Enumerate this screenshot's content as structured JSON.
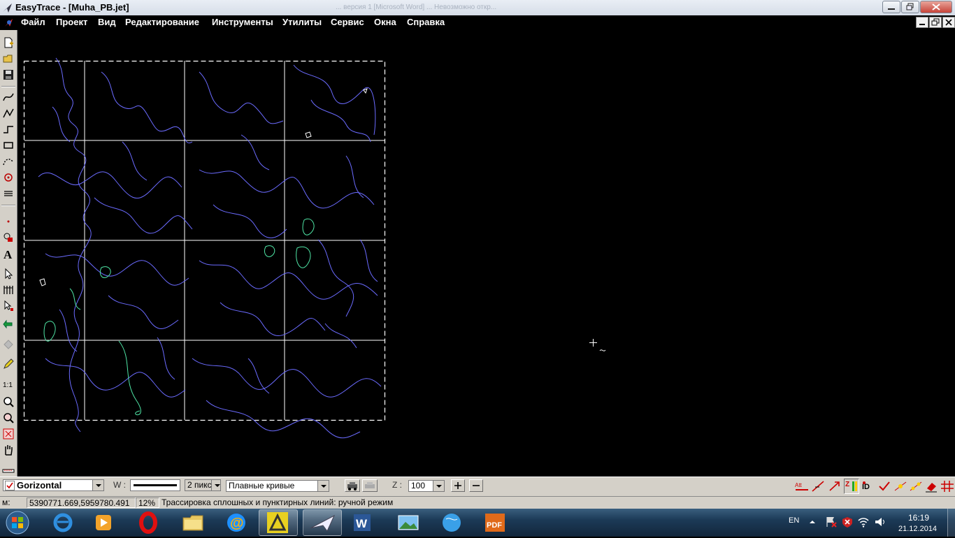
{
  "window": {
    "title": "EasyTrace - [Muha_PB.jet]",
    "ghost_title": "... версия 1 [Microsoft Word] ... Невозможно откр..."
  },
  "menu": [
    "Файл",
    "Проект",
    "Вид",
    "Редактирование",
    "Инструменты",
    "Утилиты",
    "Сервис",
    "Окна",
    "Справка"
  ],
  "propbar": {
    "layer_name": "Gorizontal",
    "width_label": "W :",
    "width_value": "2 пикс",
    "curve_mode": "Плавные кривые",
    "zoom_label": "Z :",
    "zoom_value": "100"
  },
  "status": {
    "units": "м:",
    "coords": "5390771.669,5959780.491",
    "percent": "12%",
    "message": "Трассировка сплошных и пунктирных линий: ручной режим"
  },
  "tray": {
    "lang": "EN",
    "time": "16:19",
    "date": "21.12.2014"
  },
  "toolbar_left": [
    "new-file-icon",
    "open-folder-icon",
    "save-icon",
    "smooth-curve-icon",
    "polyline-icon",
    "step-line-icon",
    "rectangle-icon",
    "dotted-curve-icon",
    "point-marker-icon",
    "hatch-icon",
    "small-point-icon",
    "shape-select-icon",
    "text-tool-icon",
    "pointer-icon",
    "multi-select-icon",
    "node-select-icon",
    "undo-arrow-icon",
    "fill-icon",
    "pencil-icon",
    "one-to-one-zoom-icon",
    "zoom-icon",
    "zoom-window-icon",
    "zoom-extents-icon",
    "pan-hand-icon",
    "scale-ruler-icon"
  ],
  "colors": {
    "contour": "#6b6bff",
    "accent_green": "#4fe6a6",
    "grid": "#ffffff",
    "ui_face": "#d4d0c8"
  }
}
